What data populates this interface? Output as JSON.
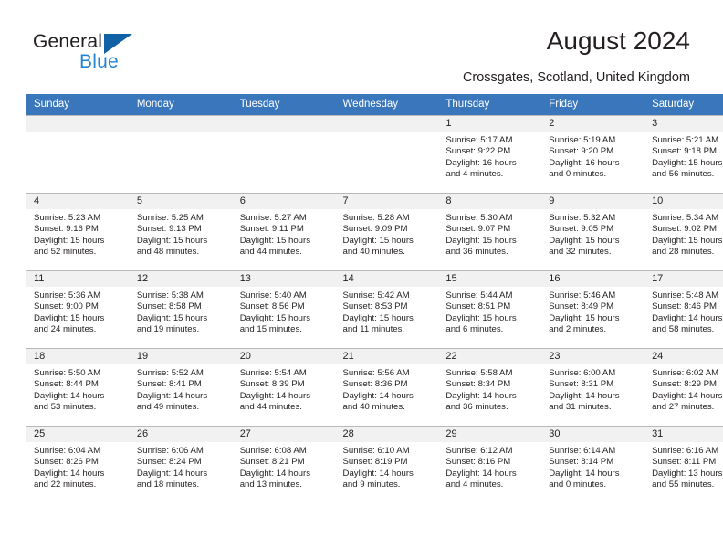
{
  "brand": {
    "name_part1": "General",
    "name_part2": "Blue",
    "triangle_color": "#1061a5",
    "blue_text_color": "#2585d3"
  },
  "header": {
    "title": "August 2024",
    "location": "Crossgates, Scotland, United Kingdom"
  },
  "theme": {
    "header_row_bg": "#3a76bb",
    "day_number_band_bg": "#f1f1f1",
    "grid_line": "#b9b9b9",
    "text": "#231f20"
  },
  "weekdays": [
    "Sunday",
    "Monday",
    "Tuesday",
    "Wednesday",
    "Thursday",
    "Friday",
    "Saturday"
  ],
  "weeks": [
    [
      {
        "day": "",
        "lines": []
      },
      {
        "day": "",
        "lines": []
      },
      {
        "day": "",
        "lines": []
      },
      {
        "day": "",
        "lines": []
      },
      {
        "day": "1",
        "lines": [
          "Sunrise: 5:17 AM",
          "Sunset: 9:22 PM",
          "Daylight: 16 hours",
          "and 4 minutes."
        ]
      },
      {
        "day": "2",
        "lines": [
          "Sunrise: 5:19 AM",
          "Sunset: 9:20 PM",
          "Daylight: 16 hours",
          "and 0 minutes."
        ]
      },
      {
        "day": "3",
        "lines": [
          "Sunrise: 5:21 AM",
          "Sunset: 9:18 PM",
          "Daylight: 15 hours",
          "and 56 minutes."
        ]
      }
    ],
    [
      {
        "day": "4",
        "lines": [
          "Sunrise: 5:23 AM",
          "Sunset: 9:16 PM",
          "Daylight: 15 hours",
          "and 52 minutes."
        ]
      },
      {
        "day": "5",
        "lines": [
          "Sunrise: 5:25 AM",
          "Sunset: 9:13 PM",
          "Daylight: 15 hours",
          "and 48 minutes."
        ]
      },
      {
        "day": "6",
        "lines": [
          "Sunrise: 5:27 AM",
          "Sunset: 9:11 PM",
          "Daylight: 15 hours",
          "and 44 minutes."
        ]
      },
      {
        "day": "7",
        "lines": [
          "Sunrise: 5:28 AM",
          "Sunset: 9:09 PM",
          "Daylight: 15 hours",
          "and 40 minutes."
        ]
      },
      {
        "day": "8",
        "lines": [
          "Sunrise: 5:30 AM",
          "Sunset: 9:07 PM",
          "Daylight: 15 hours",
          "and 36 minutes."
        ]
      },
      {
        "day": "9",
        "lines": [
          "Sunrise: 5:32 AM",
          "Sunset: 9:05 PM",
          "Daylight: 15 hours",
          "and 32 minutes."
        ]
      },
      {
        "day": "10",
        "lines": [
          "Sunrise: 5:34 AM",
          "Sunset: 9:02 PM",
          "Daylight: 15 hours",
          "and 28 minutes."
        ]
      }
    ],
    [
      {
        "day": "11",
        "lines": [
          "Sunrise: 5:36 AM",
          "Sunset: 9:00 PM",
          "Daylight: 15 hours",
          "and 24 minutes."
        ]
      },
      {
        "day": "12",
        "lines": [
          "Sunrise: 5:38 AM",
          "Sunset: 8:58 PM",
          "Daylight: 15 hours",
          "and 19 minutes."
        ]
      },
      {
        "day": "13",
        "lines": [
          "Sunrise: 5:40 AM",
          "Sunset: 8:56 PM",
          "Daylight: 15 hours",
          "and 15 minutes."
        ]
      },
      {
        "day": "14",
        "lines": [
          "Sunrise: 5:42 AM",
          "Sunset: 8:53 PM",
          "Daylight: 15 hours",
          "and 11 minutes."
        ]
      },
      {
        "day": "15",
        "lines": [
          "Sunrise: 5:44 AM",
          "Sunset: 8:51 PM",
          "Daylight: 15 hours",
          "and 6 minutes."
        ]
      },
      {
        "day": "16",
        "lines": [
          "Sunrise: 5:46 AM",
          "Sunset: 8:49 PM",
          "Daylight: 15 hours",
          "and 2 minutes."
        ]
      },
      {
        "day": "17",
        "lines": [
          "Sunrise: 5:48 AM",
          "Sunset: 8:46 PM",
          "Daylight: 14 hours",
          "and 58 minutes."
        ]
      }
    ],
    [
      {
        "day": "18",
        "lines": [
          "Sunrise: 5:50 AM",
          "Sunset: 8:44 PM",
          "Daylight: 14 hours",
          "and 53 minutes."
        ]
      },
      {
        "day": "19",
        "lines": [
          "Sunrise: 5:52 AM",
          "Sunset: 8:41 PM",
          "Daylight: 14 hours",
          "and 49 minutes."
        ]
      },
      {
        "day": "20",
        "lines": [
          "Sunrise: 5:54 AM",
          "Sunset: 8:39 PM",
          "Daylight: 14 hours",
          "and 44 minutes."
        ]
      },
      {
        "day": "21",
        "lines": [
          "Sunrise: 5:56 AM",
          "Sunset: 8:36 PM",
          "Daylight: 14 hours",
          "and 40 minutes."
        ]
      },
      {
        "day": "22",
        "lines": [
          "Sunrise: 5:58 AM",
          "Sunset: 8:34 PM",
          "Daylight: 14 hours",
          "and 36 minutes."
        ]
      },
      {
        "day": "23",
        "lines": [
          "Sunrise: 6:00 AM",
          "Sunset: 8:31 PM",
          "Daylight: 14 hours",
          "and 31 minutes."
        ]
      },
      {
        "day": "24",
        "lines": [
          "Sunrise: 6:02 AM",
          "Sunset: 8:29 PM",
          "Daylight: 14 hours",
          "and 27 minutes."
        ]
      }
    ],
    [
      {
        "day": "25",
        "lines": [
          "Sunrise: 6:04 AM",
          "Sunset: 8:26 PM",
          "Daylight: 14 hours",
          "and 22 minutes."
        ]
      },
      {
        "day": "26",
        "lines": [
          "Sunrise: 6:06 AM",
          "Sunset: 8:24 PM",
          "Daylight: 14 hours",
          "and 18 minutes."
        ]
      },
      {
        "day": "27",
        "lines": [
          "Sunrise: 6:08 AM",
          "Sunset: 8:21 PM",
          "Daylight: 14 hours",
          "and 13 minutes."
        ]
      },
      {
        "day": "28",
        "lines": [
          "Sunrise: 6:10 AM",
          "Sunset: 8:19 PM",
          "Daylight: 14 hours",
          "and 9 minutes."
        ]
      },
      {
        "day": "29",
        "lines": [
          "Sunrise: 6:12 AM",
          "Sunset: 8:16 PM",
          "Daylight: 14 hours",
          "and 4 minutes."
        ]
      },
      {
        "day": "30",
        "lines": [
          "Sunrise: 6:14 AM",
          "Sunset: 8:14 PM",
          "Daylight: 14 hours",
          "and 0 minutes."
        ]
      },
      {
        "day": "31",
        "lines": [
          "Sunrise: 6:16 AM",
          "Sunset: 8:11 PM",
          "Daylight: 13 hours",
          "and 55 minutes."
        ]
      }
    ]
  ]
}
